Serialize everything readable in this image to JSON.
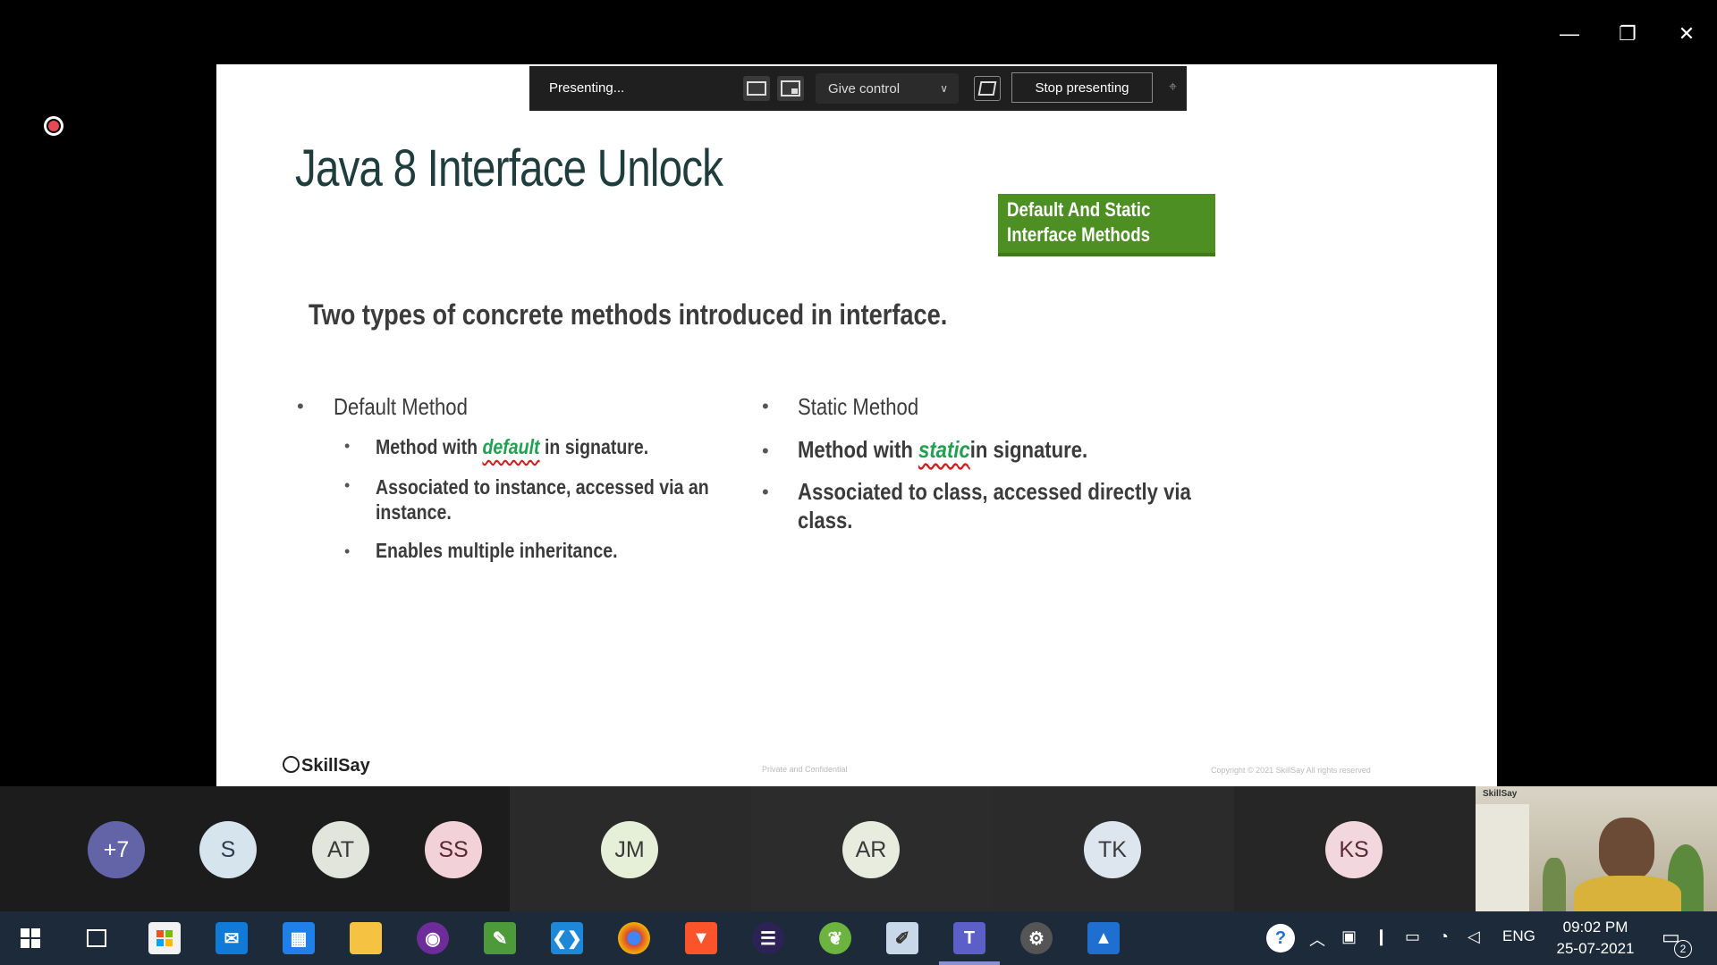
{
  "window": {
    "minimize": "—",
    "restore": "❐",
    "close": "✕"
  },
  "presenting_bar": {
    "status": "Presenting...",
    "give_control": "Give control",
    "stop": "Stop presenting"
  },
  "slide": {
    "title": "Java 8 Interface Unlock",
    "badge_line1": "Default And Static",
    "badge_line2": "Interface Methods",
    "subtitle": "Two types of concrete methods introduced in interface.",
    "left": {
      "heading": "Default Method",
      "item1_pre": "Method with ",
      "item1_kw": "default",
      "item1_post": " in signature.",
      "item2_line1": "Associated to instance, accessed via an",
      "item2_line2": "instance.",
      "item3": "Enables multiple inheritance."
    },
    "right": {
      "heading": "Static Method",
      "item1_pre": "Method with ",
      "item1_kw": "static",
      "item1_post": "in signature.",
      "item2_line1": "Associated to class, accessed directly via",
      "item2_line2": "class."
    },
    "brand": "SkillSay",
    "footer_center": "Private and Confidential",
    "footer_right": "Copyright © 2021 SkillSay All rights reserved"
  },
  "participants": [
    {
      "initials": "+7",
      "color": "#6264a7",
      "text_color": "#ffffff"
    },
    {
      "initials": "S",
      "color": "#d6e4ee",
      "text_color": "#2d3d4a"
    },
    {
      "initials": "AT",
      "color": "#e2e5dc",
      "text_color": "#3a3a3a"
    },
    {
      "initials": "SS",
      "color": "#f2d2d8",
      "text_color": "#5a2a34"
    },
    {
      "initials": "JM",
      "color": "#e6efd8",
      "text_color": "#3a3a3a"
    },
    {
      "initials": "AR",
      "color": "#e8ecdf",
      "text_color": "#3a3a3a"
    },
    {
      "initials": "TK",
      "color": "#dde6ee",
      "text_color": "#3a3a3a"
    },
    {
      "initials": "KS",
      "color": "#f2d8de",
      "text_color": "#5a2a34"
    }
  ],
  "selfview": {
    "brand": "SkillSay"
  },
  "taskbar": {
    "tray_lang": "ENG",
    "time": "09:02 PM",
    "date": "25-07-2021",
    "notifications": "2"
  }
}
